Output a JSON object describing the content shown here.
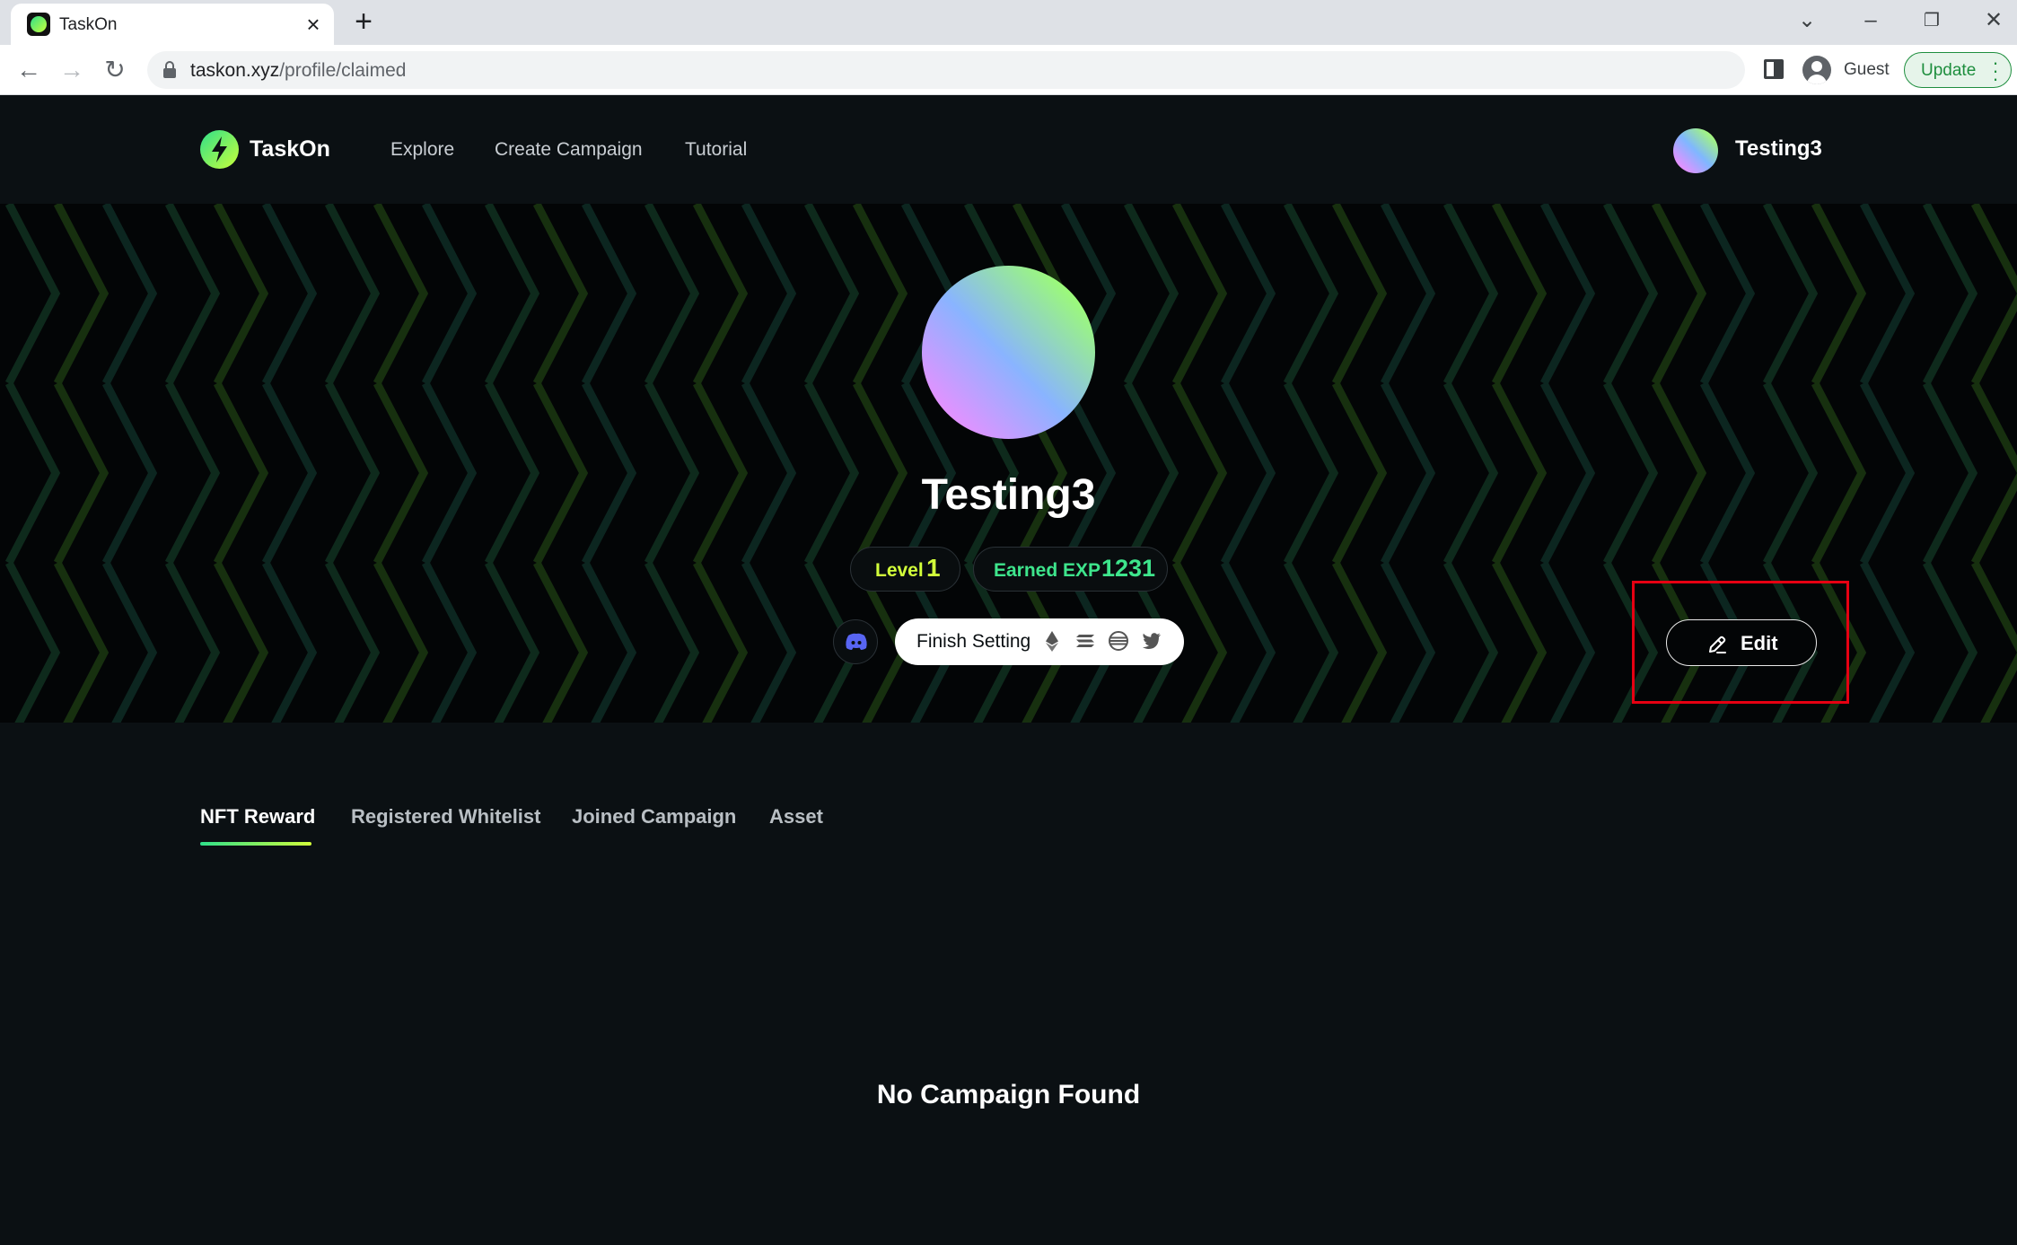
{
  "browser": {
    "tab_title": "TaskOn",
    "url_host": "taskon.xyz",
    "url_path": "/profile/claimed",
    "profile_label": "Guest",
    "update_label": "Update"
  },
  "header": {
    "brand": "TaskOn",
    "nav": [
      "Explore",
      "Create Campaign",
      "Tutorial"
    ],
    "username": "Testing3"
  },
  "profile": {
    "name": "Testing3",
    "level_label": "Level",
    "level_value": "1",
    "exp_label": "Earned EXP",
    "exp_value": "1231",
    "finish_setting_label": "Finish Setting",
    "finish_setting_icons": [
      "ethereum-icon",
      "solana-icon",
      "aptos-icon",
      "twitter-icon"
    ],
    "edit_label": "Edit"
  },
  "tabs": {
    "items": [
      "NFT Reward",
      "Registered Whitelist",
      "Joined Campaign",
      "Asset"
    ],
    "active": "NFT Reward"
  },
  "content": {
    "empty_message": "No Campaign Found"
  },
  "colors": {
    "accent_green": "#3ee58c",
    "accent_lime": "#d2ff3a",
    "highlight_red": "#e60012",
    "page_background": "#0b1013"
  }
}
